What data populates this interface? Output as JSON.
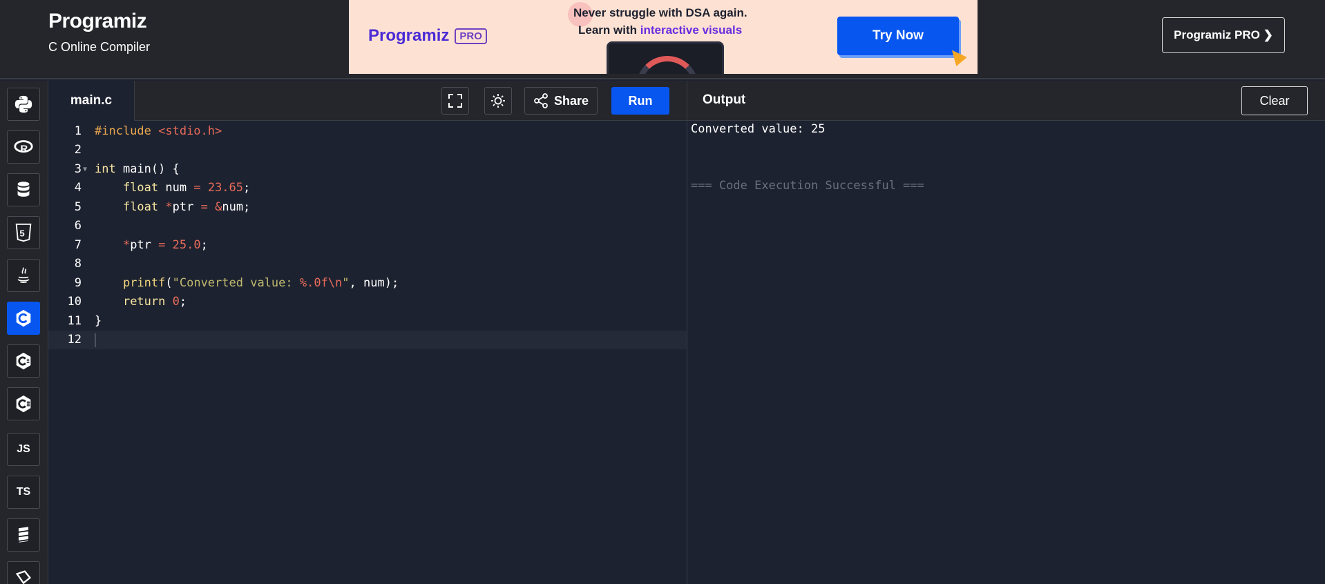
{
  "header": {
    "brand_name": "Programiz",
    "subtitle": "C Online Compiler",
    "pro_button": "Programiz PRO ❯"
  },
  "ad": {
    "brand": "Programiz",
    "pro_badge": "PRO",
    "line1": "Never struggle with DSA again.",
    "line2_prefix": "Learn with ",
    "line2_highlight": "interactive visuals",
    "cta": "Try Now"
  },
  "sidebar": {
    "languages": [
      {
        "name": "python",
        "label": ""
      },
      {
        "name": "r",
        "label": ""
      },
      {
        "name": "sql",
        "label": ""
      },
      {
        "name": "html",
        "label": ""
      },
      {
        "name": "java",
        "label": ""
      },
      {
        "name": "c",
        "label": "",
        "active": true
      },
      {
        "name": "cpp",
        "label": ""
      },
      {
        "name": "csharp",
        "label": ""
      },
      {
        "name": "javascript",
        "label": "JS"
      },
      {
        "name": "typescript",
        "label": "TS"
      },
      {
        "name": "go",
        "label": ""
      },
      {
        "name": "swift",
        "label": ""
      }
    ]
  },
  "editor": {
    "file_tab": "main.c",
    "share_label": "Share",
    "run_label": "Run",
    "line_numbers": [
      "1",
      "2",
      "3",
      "4",
      "5",
      "6",
      "7",
      "8",
      "9",
      "10",
      "11",
      "12"
    ],
    "lines": [
      "#include <stdio.h>",
      "",
      "int main() {",
      "    float num = 23.65;",
      "    float *ptr = &num;",
      "",
      "    *ptr = 25.0;",
      "",
      "    printf(\"Converted value: %.0f\\n\", num);",
      "    return 0;",
      "}",
      ""
    ]
  },
  "output": {
    "title": "Output",
    "clear_label": "Clear",
    "lines": [
      "Converted value: 25",
      "",
      "",
      "=== Code Execution Successful ==="
    ]
  },
  "colors": {
    "accent": "#0856f0",
    "background": "#1d2230",
    "panel": "#25262b"
  }
}
